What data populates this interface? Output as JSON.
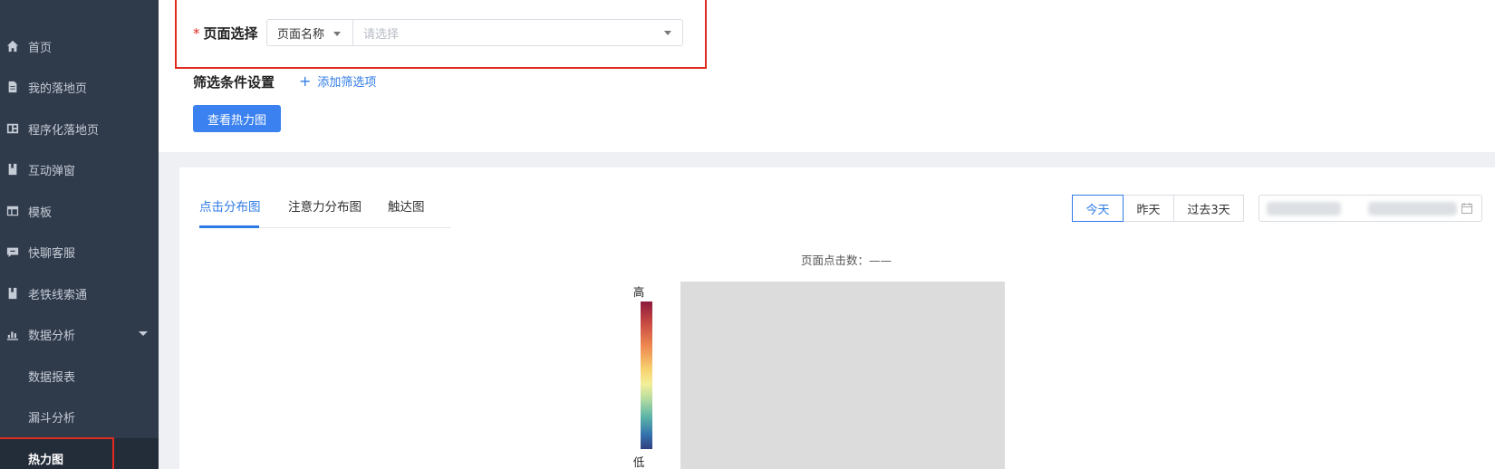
{
  "sidebar": {
    "items": [
      {
        "label": "首页",
        "icon": "home-icon"
      },
      {
        "label": "我的落地页",
        "icon": "document-icon"
      },
      {
        "label": "程序化落地页",
        "icon": "layout-icon"
      },
      {
        "label": "互动弹窗",
        "icon": "bookmark-icon"
      },
      {
        "label": "模板",
        "icon": "table-icon"
      },
      {
        "label": "快聊客服",
        "icon": "chat-icon"
      },
      {
        "label": "老铁线索通",
        "icon": "bookmark-icon"
      },
      {
        "label": "数据分析",
        "icon": "bar-chart-icon"
      }
    ],
    "sub_items": [
      {
        "label": "数据报表"
      },
      {
        "label": "漏斗分析"
      },
      {
        "label": "热力图",
        "active": true
      }
    ]
  },
  "filter": {
    "page_select_label": "页面选择",
    "required_mark": "*",
    "type_value": "页面名称",
    "page_placeholder": "请选择",
    "conditions_label": "筛选条件设置",
    "add_filter_label": "添加筛选项",
    "add_filter_plus": "+",
    "view_button": "查看热力图"
  },
  "tabs": [
    {
      "label": "点击分布图",
      "active": true
    },
    {
      "label": "注意力分布图"
    },
    {
      "label": "触达图"
    }
  ],
  "date_ranges": [
    {
      "label": "今天",
      "active": true
    },
    {
      "label": "昨天"
    },
    {
      "label": "过去3天"
    }
  ],
  "heatmap": {
    "clicks_label": "页面点击数：——",
    "legend_high": "高",
    "legend_low": "低"
  },
  "colors": {
    "sidebar_bg": "#2f3a4b",
    "accent": "#2f7be5",
    "highlight": "#e02b1e"
  }
}
